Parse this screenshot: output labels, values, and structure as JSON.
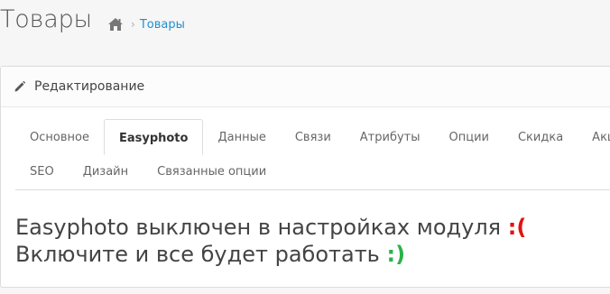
{
  "header": {
    "title": "Товары",
    "breadcrumb": {
      "home_icon": "home-icon",
      "separator": "›",
      "current": "Товары"
    }
  },
  "panel": {
    "heading_icon": "pencil-icon",
    "heading": "Редактирование",
    "tabs_row1": [
      {
        "label": "Основное",
        "active": false
      },
      {
        "label": "Easyphoto",
        "active": true
      },
      {
        "label": "Данные",
        "active": false
      },
      {
        "label": "Связи",
        "active": false
      },
      {
        "label": "Атрибуты",
        "active": false
      },
      {
        "label": "Опции",
        "active": false
      },
      {
        "label": "Скидка",
        "active": false
      },
      {
        "label": "Акция",
        "active": false
      }
    ],
    "tabs_row2": [
      {
        "label": "SEO",
        "active": false
      },
      {
        "label": "Дизайн",
        "active": false
      },
      {
        "label": "Связанные опции",
        "active": false
      }
    ],
    "message": {
      "line1": "Easyphoto выключен в настройках модуля",
      "line1_emoticon": ":(",
      "line2": "Включите и все будет работать",
      "line2_emoticon": ":)"
    }
  },
  "colors": {
    "link": "#1e91cf",
    "sad": "#e0130f",
    "happy": "#2bb24c"
  }
}
